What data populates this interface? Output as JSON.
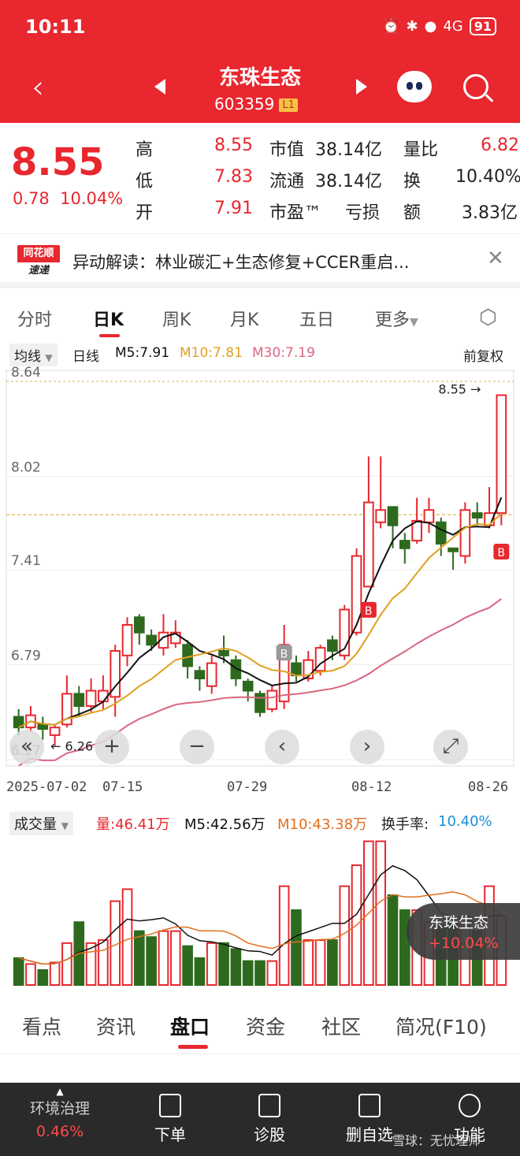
{
  "status": {
    "time": "10:11",
    "battery": "91",
    "signal": "4G"
  },
  "header": {
    "name": "东珠生态",
    "code": "603359",
    "level": "L1"
  },
  "quote": {
    "price": "8.55",
    "change": "0.78",
    "change_pct": "10.04%",
    "rows": [
      {
        "k1": "高",
        "v1": "8.55",
        "k2": "市值",
        "v2": "38.14亿",
        "k3": "量比",
        "v3": "6.82"
      },
      {
        "k1": "低",
        "v1": "7.83",
        "k2": "流通",
        "v2": "38.14亿",
        "k3": "换",
        "v3": "10.40%"
      },
      {
        "k1": "开",
        "v1": "7.91",
        "k2": "市盈™",
        "v2": "亏损",
        "k3": "额",
        "v3": "3.83亿"
      }
    ]
  },
  "news": {
    "logo_top": "同花顺",
    "logo_bottom": "速递",
    "text": "异动解读：林业碳汇+生态修复+CCER重启..."
  },
  "tabs": [
    "分时",
    "日K",
    "周K",
    "月K",
    "五日",
    "更多"
  ],
  "legend": {
    "chip": "均线",
    "period": "日线",
    "m5": "M5:7.91",
    "m10": "M10:7.81",
    "m30": "M30:7.19",
    "adj": "前复权"
  },
  "colors": {
    "up": "#e8272e",
    "down": "#2d6a1e",
    "m5": "#111111",
    "m10": "#e0a020",
    "m30": "#d9667f"
  },
  "chart_data": {
    "type": "candlestick",
    "y_ticks": [
      "8.64",
      "8.02",
      "7.41",
      "6.79",
      "6.17"
    ],
    "ylim": [
      6.17,
      8.64
    ],
    "x_ticks": [
      "2025-07-02",
      "07-15",
      "07-29",
      "08-12",
      "08-26"
    ],
    "max_label": "8.55",
    "min_label": "6.26",
    "candles": [
      {
        "o": 6.45,
        "c": 6.38,
        "h": 6.5,
        "l": 6.33
      },
      {
        "o": 6.38,
        "c": 6.46,
        "h": 6.52,
        "l": 6.35
      },
      {
        "o": 6.4,
        "c": 6.37,
        "h": 6.45,
        "l": 6.3
      },
      {
        "o": 6.33,
        "c": 6.38,
        "h": 6.4,
        "l": 6.26
      },
      {
        "o": 6.4,
        "c": 6.6,
        "h": 6.72,
        "l": 6.38
      },
      {
        "o": 6.6,
        "c": 6.52,
        "h": 6.65,
        "l": 6.45
      },
      {
        "o": 6.52,
        "c": 6.62,
        "h": 6.7,
        "l": 6.48
      },
      {
        "o": 6.55,
        "c": 6.62,
        "h": 6.72,
        "l": 6.5
      },
      {
        "o": 6.58,
        "c": 6.88,
        "h": 6.92,
        "l": 6.45
      },
      {
        "o": 6.85,
        "c": 7.05,
        "h": 7.1,
        "l": 6.78
      },
      {
        "o": 7.1,
        "c": 7.0,
        "h": 7.12,
        "l": 6.92
      },
      {
        "o": 6.98,
        "c": 6.92,
        "h": 7.02,
        "l": 6.88
      },
      {
        "o": 6.9,
        "c": 7.0,
        "h": 7.12,
        "l": 6.85
      },
      {
        "o": 6.93,
        "c": 7.0,
        "h": 7.08,
        "l": 6.9
      },
      {
        "o": 6.92,
        "c": 6.78,
        "h": 6.95,
        "l": 6.7
      },
      {
        "o": 6.75,
        "c": 6.7,
        "h": 6.78,
        "l": 6.62
      },
      {
        "o": 6.65,
        "c": 6.8,
        "h": 6.85,
        "l": 6.6
      },
      {
        "o": 6.88,
        "c": 6.85,
        "h": 6.98,
        "l": 6.8
      },
      {
        "o": 6.82,
        "c": 6.7,
        "h": 6.85,
        "l": 6.65
      },
      {
        "o": 6.68,
        "c": 6.62,
        "h": 6.7,
        "l": 6.55
      },
      {
        "o": 6.6,
        "c": 6.48,
        "h": 6.62,
        "l": 6.45
      },
      {
        "o": 6.5,
        "c": 6.62,
        "h": 6.65,
        "l": 6.48
      },
      {
        "o": 6.55,
        "c": 6.92,
        "h": 7.05,
        "l": 6.5
      },
      {
        "o": 6.8,
        "c": 6.72,
        "h": 6.85,
        "l": 6.68
      },
      {
        "o": 6.7,
        "c": 6.82,
        "h": 6.88,
        "l": 6.68
      },
      {
        "o": 6.75,
        "c": 6.9,
        "h": 6.92,
        "l": 6.72
      },
      {
        "o": 6.95,
        "c": 6.88,
        "h": 6.98,
        "l": 6.82
      },
      {
        "o": 6.85,
        "c": 7.15,
        "h": 7.18,
        "l": 6.82
      },
      {
        "o": 7.0,
        "c": 7.5,
        "h": 7.55,
        "l": 6.98
      },
      {
        "o": 7.3,
        "c": 7.85,
        "h": 8.15,
        "l": 7.3
      },
      {
        "o": 7.72,
        "c": 7.8,
        "h": 8.15,
        "l": 7.68
      },
      {
        "o": 7.82,
        "c": 7.7,
        "h": 7.82,
        "l": 7.55
      },
      {
        "o": 7.6,
        "c": 7.55,
        "h": 7.65,
        "l": 7.45
      },
      {
        "o": 7.6,
        "c": 7.73,
        "h": 7.88,
        "l": 7.58
      },
      {
        "o": 7.72,
        "c": 7.8,
        "h": 7.88,
        "l": 7.65
      },
      {
        "o": 7.72,
        "c": 7.58,
        "h": 7.75,
        "l": 7.5
      },
      {
        "o": 7.55,
        "c": 7.53,
        "h": 7.55,
        "l": 7.41
      },
      {
        "o": 7.5,
        "c": 7.8,
        "h": 7.85,
        "l": 7.45
      },
      {
        "o": 7.78,
        "c": 7.75,
        "h": 7.85,
        "l": 7.7
      },
      {
        "o": 7.7,
        "c": 7.78,
        "h": 7.95,
        "l": 7.68
      },
      {
        "o": 7.78,
        "c": 8.55,
        "h": 8.55,
        "l": 7.7
      }
    ]
  },
  "vol_legend": {
    "chip": "成交量",
    "vol": "量:46.41万",
    "m5": "M5:42.56万",
    "m10": "M10:43.38万",
    "turnover_label": "换手率:",
    "turnover": "10.40%"
  },
  "float_tag": {
    "name": "东珠生态",
    "pct": "+10.04%"
  },
  "bottom_tabs": [
    "看点",
    "资讯",
    "盘口",
    "资金",
    "社区",
    "简况(F10)"
  ],
  "footer": {
    "index_name": "环境治理",
    "index_pct": "0.46%",
    "items": [
      "下单",
      "诊股",
      "删自选",
      "功能"
    ],
    "watermark": "雪球：无忧理师"
  }
}
